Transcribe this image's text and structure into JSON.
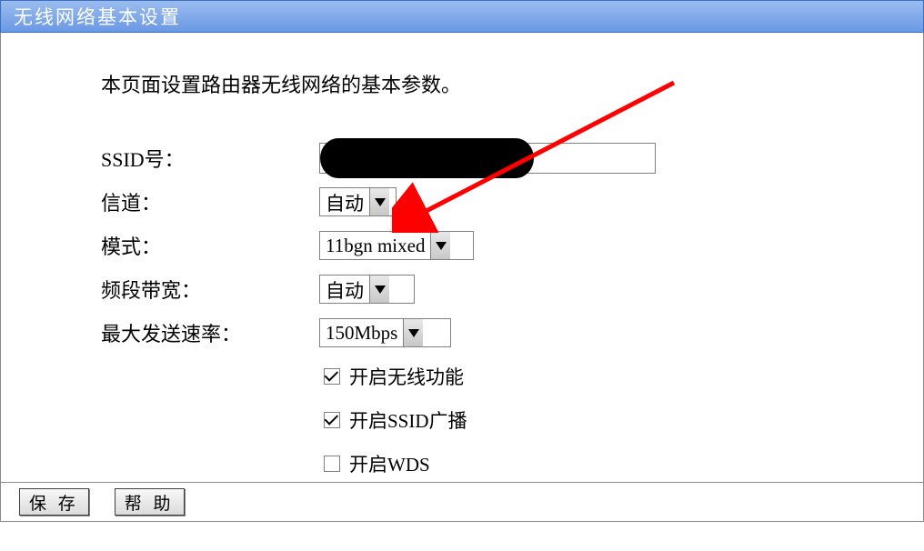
{
  "title": "无线网络基本设置",
  "description": "本页面设置路由器无线网络的基本参数。",
  "fields": {
    "ssid": {
      "label": "SSID号：",
      "value": ""
    },
    "channel": {
      "label": "信道：",
      "value": "自动"
    },
    "mode": {
      "label": "模式：",
      "value": "11bgn mixed"
    },
    "band": {
      "label": "频段带宽：",
      "value": "自动"
    },
    "rate": {
      "label": "最大发送速率：",
      "value": "150Mbps"
    }
  },
  "checks": {
    "wireless_enable": {
      "label": "开启无线功能",
      "checked": true
    },
    "ssid_broadcast": {
      "label": "开启SSID广播",
      "checked": true
    },
    "wds": {
      "label": "开启WDS",
      "checked": false
    }
  },
  "buttons": {
    "save": "保 存",
    "help": "帮 助"
  },
  "annotation": {
    "arrow_color": "#ff0000"
  }
}
